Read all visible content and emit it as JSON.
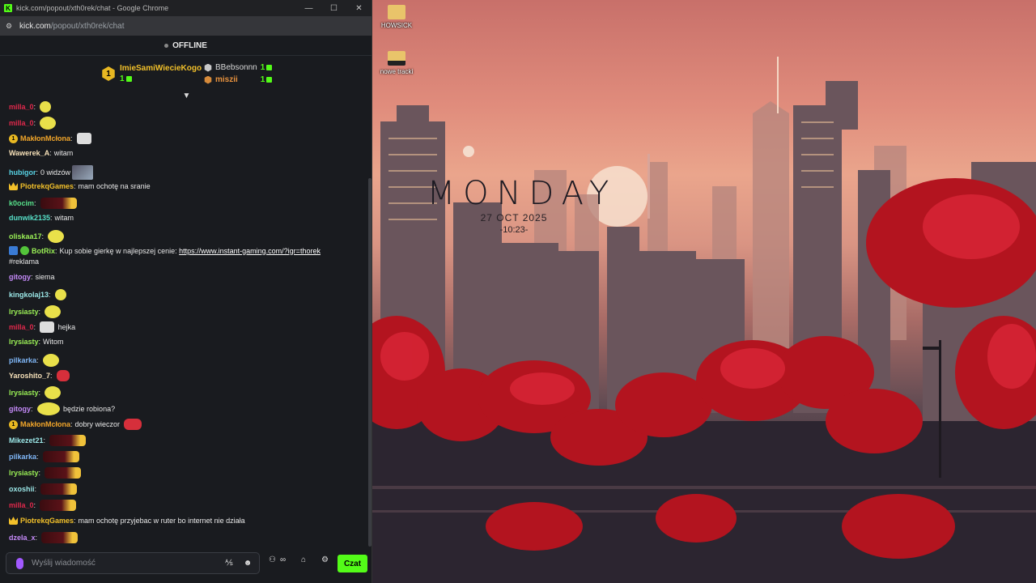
{
  "window": {
    "title": "kick.com/popout/xth0rek/chat - Google Chrome",
    "logo_letter": "K",
    "url_host": "kick.com",
    "url_path": "/popout/xth0rek/chat",
    "minimize": "—",
    "maximize": "☐",
    "close": "✕"
  },
  "stream": {
    "status": "OFFLINE"
  },
  "leaderboard": {
    "first": {
      "rank": "1",
      "name": "ImieSamiWiecieKogo",
      "count": "1"
    },
    "second": {
      "name": "BBebsonnn",
      "count": "1"
    },
    "third": {
      "name": "miszii",
      "count": "1"
    }
  },
  "chat": {
    "messages": [
      {
        "user": "milla_0",
        "color": "#e0284b",
        "text": ""
      },
      {
        "user": "milla_0",
        "color": "#e0284b",
        "text": ""
      },
      {
        "user": "MakłonMcłona",
        "color": "#f2a62a",
        "text": ""
      },
      {
        "user": "Wawerek_A",
        "color": "#f6e0b8",
        "text": "witam"
      },
      {
        "user": "hubigor",
        "color": "#57d1e3",
        "text": "0 widzów"
      },
      {
        "user": "PiotrekqGames",
        "color": "#f2c02a",
        "text": "mam ochotę na sranie"
      },
      {
        "user": "k0ocim",
        "color": "#57e08a",
        "text": ""
      },
      {
        "user": "dunwik2135",
        "color": "#57e0c8",
        "text": "witam"
      },
      {
        "user": "oliskaa17",
        "color": "#9aef56",
        "text": ""
      },
      {
        "user": "BotRix",
        "color": "#9aef56",
        "text": "Kup sobie gierkę w najlepszej cenie:",
        "link": "https://www.instant-gaming.com/?igr=thorek",
        "text2": "#reklama"
      },
      {
        "user": "gitogy",
        "color": "#c58af9",
        "text": "siema"
      },
      {
        "user": "kingkolaj13",
        "color": "#9ae6e6",
        "text": ""
      },
      {
        "user": "lrysiasty",
        "color": "#9aef56",
        "text": ""
      },
      {
        "user": "milla_0",
        "color": "#e0284b",
        "text": "hejka"
      },
      {
        "user": "lrysiasty",
        "color": "#9aef56",
        "text": "Witom"
      },
      {
        "user": "pilkarka",
        "color": "#7fb6f6",
        "text": ""
      },
      {
        "user": "Yaroshito_7",
        "color": "#f6e0b8",
        "text": ""
      },
      {
        "user": "lrysiasty",
        "color": "#9aef56",
        "text": ""
      },
      {
        "user": "gitogy",
        "color": "#c58af9",
        "text": "będzie robiona?"
      },
      {
        "user": "MakłonMcłona",
        "color": "#f2a62a",
        "text": "dobry wieczor"
      },
      {
        "user": "Mikezet21",
        "color": "#9ae6e6",
        "text": ""
      },
      {
        "user": "pilkarka",
        "color": "#7fb6f6",
        "text": ""
      },
      {
        "user": "lrysiasty",
        "color": "#9aef56",
        "text": ""
      },
      {
        "user": "oxoshii",
        "color": "#9ae6e6",
        "text": ""
      },
      {
        "user": "milla_0",
        "color": "#e0284b",
        "text": ""
      },
      {
        "user": "PiotrekqGames",
        "color": "#f2c02a",
        "text": "mam ochotę przyjebac w ruter bo internet nie działa"
      },
      {
        "user": "dzela_x",
        "color": "#c58af9",
        "text": ""
      }
    ]
  },
  "input": {
    "placeholder": "Wyślij wiadomość",
    "send_label": "Czat"
  },
  "desktop": {
    "widget_day": "MONDAY",
    "widget_date": "27 OCT 2025",
    "widget_time": "-10:23-",
    "icons": [
      {
        "label": "HOWSICK"
      },
      {
        "label": "nowe tracki"
      }
    ]
  },
  "colors": {
    "kick_green": "#53fc18",
    "gold": "#f2c02a"
  }
}
